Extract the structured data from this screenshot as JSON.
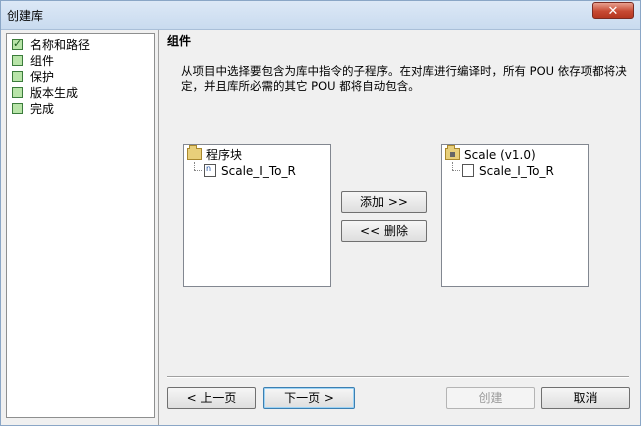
{
  "window": {
    "title": "创建库",
    "close_glyph": "✕"
  },
  "nav": {
    "items": [
      {
        "label": "名称和路径",
        "checked": true
      },
      {
        "label": "组件",
        "checked": false
      },
      {
        "label": "保护",
        "checked": false
      },
      {
        "label": "版本生成",
        "checked": false
      },
      {
        "label": "完成",
        "checked": false
      }
    ]
  },
  "main": {
    "heading": "组件",
    "description": "从项目中选择要包含为库中指令的子程序。在对库进行编译时，所有 POU 依存项都将决定，并且库所必需的其它 POU 都将自动包含。",
    "available": {
      "root": "程序块",
      "items": [
        "Scale_I_To_R"
      ]
    },
    "selected": {
      "root": "Scale (v1.0)",
      "items": [
        "Scale_I_To_R"
      ]
    },
    "add_button": "添加 >>",
    "remove_button": "<< 删除"
  },
  "footer": {
    "prev": "< 上一页",
    "next": "下一页 >",
    "create": "创建",
    "cancel": "取消"
  }
}
